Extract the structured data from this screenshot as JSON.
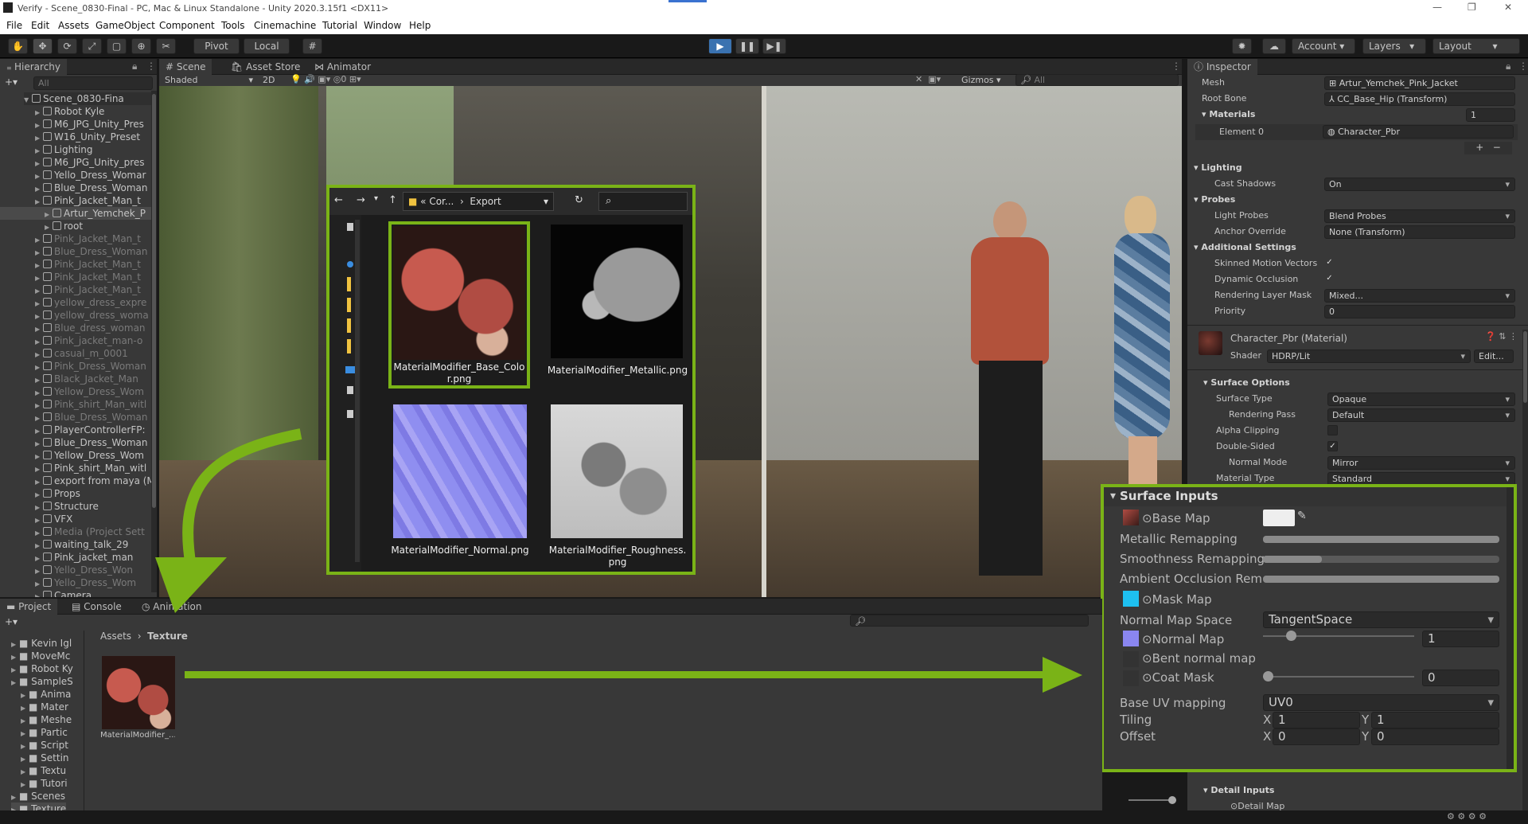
{
  "window": {
    "title": "Verify - Scene_0830-Final - PC, Mac & Linux Standalone - Unity 2020.3.15f1 <DX11>"
  },
  "menu": [
    "File",
    "Edit",
    "Assets",
    "GameObject",
    "Component",
    "Tools",
    "Cinemachine",
    "Tutorial",
    "Window",
    "Help"
  ],
  "toolbar": {
    "pivot": "Pivot",
    "local": "Local",
    "account": "Account",
    "layers": "Layers",
    "layout": "Layout"
  },
  "hierarchy": {
    "title": "Hierarchy",
    "search_placeholder": "All",
    "scene": "Scene_0830-Fina",
    "items": [
      {
        "label": "Robot Kyle",
        "dim": false,
        "indent": 1
      },
      {
        "label": "M6_JPG_Unity_Pres",
        "dim": false,
        "indent": 1
      },
      {
        "label": "W16_Unity_Preset",
        "dim": false,
        "indent": 1
      },
      {
        "label": "Lighting",
        "dim": false,
        "indent": 1
      },
      {
        "label": "M6_JPG_Unity_pres",
        "dim": false,
        "indent": 1
      },
      {
        "label": "Yello_Dress_Womar",
        "dim": false,
        "indent": 1
      },
      {
        "label": "Blue_Dress_Woman",
        "dim": false,
        "indent": 1
      },
      {
        "label": "Pink_Jacket_Man_t",
        "dim": false,
        "indent": 1
      },
      {
        "label": "Artur_Yemchek_P",
        "dim": false,
        "indent": 2
      },
      {
        "label": "root",
        "dim": false,
        "indent": 2
      },
      {
        "label": "Pink_Jacket_Man_t",
        "dim": true,
        "indent": 1
      },
      {
        "label": "Blue_Dress_Woman",
        "dim": true,
        "indent": 1
      },
      {
        "label": "Pink_Jacket_Man_t",
        "dim": true,
        "indent": 1
      },
      {
        "label": "Pink_Jacket_Man_t",
        "dim": true,
        "indent": 1
      },
      {
        "label": "Pink_Jacket_Man_t",
        "dim": true,
        "indent": 1
      },
      {
        "label": "yellow_dress_expre",
        "dim": true,
        "indent": 1
      },
      {
        "label": "yellow_dress_woma",
        "dim": true,
        "indent": 1
      },
      {
        "label": "Blue_dress_woman",
        "dim": true,
        "indent": 1
      },
      {
        "label": "Pink_jacket_man-o",
        "dim": true,
        "indent": 1
      },
      {
        "label": "casual_m_0001",
        "dim": true,
        "indent": 1
      },
      {
        "label": "Pink_Dress_Woman",
        "dim": true,
        "indent": 1
      },
      {
        "label": "Black_Jacket_Man",
        "dim": true,
        "indent": 1
      },
      {
        "label": "Yellow_Dress_Wom",
        "dim": true,
        "indent": 1
      },
      {
        "label": "Pink_shirt_Man_witl",
        "dim": true,
        "indent": 1
      },
      {
        "label": "Blue_Dress_Woman",
        "dim": true,
        "indent": 1
      },
      {
        "label": "PlayerControllerFP:",
        "dim": false,
        "indent": 1
      },
      {
        "label": "Blue_Dress_Woman",
        "dim": false,
        "indent": 1
      },
      {
        "label": "Yellow_Dress_Wom",
        "dim": false,
        "indent": 1
      },
      {
        "label": "Pink_shirt_Man_witl",
        "dim": false,
        "indent": 1
      },
      {
        "label": "export from maya (M",
        "dim": false,
        "indent": 1
      },
      {
        "label": "Props",
        "dim": false,
        "indent": 1
      },
      {
        "label": "Structure",
        "dim": false,
        "indent": 1
      },
      {
        "label": "VFX",
        "dim": false,
        "indent": 1
      },
      {
        "label": "Media (Project Sett",
        "dim": true,
        "indent": 1
      },
      {
        "label": "waiting_talk_29",
        "dim": false,
        "indent": 1
      },
      {
        "label": "Pink_jacket_man",
        "dim": false,
        "indent": 1
      },
      {
        "label": "Yello_Dress_Won",
        "dim": true,
        "indent": 1
      },
      {
        "label": "Yello_Dress_Wom",
        "dim": true,
        "indent": 1
      },
      {
        "label": "Camera",
        "dim": false,
        "indent": 1
      }
    ]
  },
  "scene_tabs": [
    "Scene",
    "Asset Store",
    "Animator"
  ],
  "scene_toolbar": {
    "shading": "Shaded",
    "mode2d": "2D",
    "gizmos": "Gizmos",
    "search": "All",
    "fx_count": "0"
  },
  "explorer": {
    "path": [
      "Cor...",
      "Export"
    ],
    "files": [
      "MaterialModifier_Base_Color.png",
      "MaterialModifier_Metallic.png",
      "MaterialModifier_Normal.png",
      "MaterialModifier_Roughness.png"
    ]
  },
  "inspector": {
    "title": "Inspector",
    "mesh_label": "Mesh",
    "mesh_value": "Artur_Yemchek_Pink_Jacket",
    "rootbone_label": "Root Bone",
    "rootbone_value": "CC_Base_Hip (Transform)",
    "materials_label": "Materials",
    "materials_count": "1",
    "element_label": "Element 0",
    "element_value": "Character_Pbr",
    "lighting": "Lighting",
    "cast_shadows": "Cast Shadows",
    "cast_shadows_value": "On",
    "probes": "Probes",
    "light_probes": "Light Probes",
    "light_probes_value": "Blend Probes",
    "anchor": "Anchor Override",
    "anchor_value": "None (Transform)",
    "additional": "Additional Settings",
    "skinned": "Skinned Motion Vectors",
    "dynamic_occ": "Dynamic Occlusion",
    "render_layer": "Rendering Layer Mask",
    "render_layer_value": "Mixed...",
    "priority": "Priority",
    "priority_value": "0",
    "material_name": "Character_Pbr (Material)",
    "shader_label": "Shader",
    "shader_value": "HDRP/Lit",
    "edit": "Edit...",
    "surface_options": "Surface Options",
    "surface_type": "Surface Type",
    "surface_type_value": "Opaque",
    "rendering_pass": "Rendering Pass",
    "rendering_pass_value": "Default",
    "alpha_clip": "Alpha Clipping",
    "double_sided": "Double-Sided",
    "normal_mode": "Normal Mode",
    "normal_mode_value": "Mirror",
    "material_type": "Material Type",
    "material_type_value": "Standard",
    "detail_inputs": "Detail Inputs",
    "detail_map": "Detail Map"
  },
  "surface_inputs": {
    "title": "Surface Inputs",
    "base_map": "Base Map",
    "metallic": "Metallic Remapping",
    "metallic_range": [
      0.0,
      1.0
    ],
    "smoothness": "Smoothness Remapping",
    "smoothness_range": [
      0.0,
      0.25
    ],
    "ao": "Ambient Occlusion Rema",
    "ao_range": [
      0.0,
      1.0
    ],
    "mask_map": "Mask Map",
    "normal_space": "Normal Map Space",
    "normal_space_value": "TangentSpace",
    "normal_map": "Normal Map",
    "normal_value": "1",
    "normal_level": 0.15,
    "bent_normal": "Bent normal map",
    "coat_mask": "Coat Mask",
    "coat_value": "0",
    "coat_level": 0.0,
    "uv_mapping": "Base UV mapping",
    "uv_value": "UV0",
    "tiling": "Tiling",
    "tiling_x": "1",
    "tiling_y": "1",
    "offset": "Offset",
    "offset_x": "0",
    "offset_y": "0",
    "x": "X",
    "y": "Y"
  },
  "project": {
    "tabs": [
      "Project",
      "Console",
      "Animation"
    ],
    "breadcrumb_root": "Assets",
    "breadcrumb_current": "Texture",
    "folders": [
      "Kevin Igl",
      "MoveMc",
      "Robot Ky",
      "SampleS",
      "Anima",
      "Mater",
      "Meshe",
      "Partic",
      "Script",
      "Settin",
      "Textu",
      "Tutori",
      "Scenes",
      "Texture"
    ],
    "asset_name": "MaterialModifier_..."
  },
  "colors": {
    "accent_green": "#7ab317",
    "play_blue": "#3a72b0"
  }
}
